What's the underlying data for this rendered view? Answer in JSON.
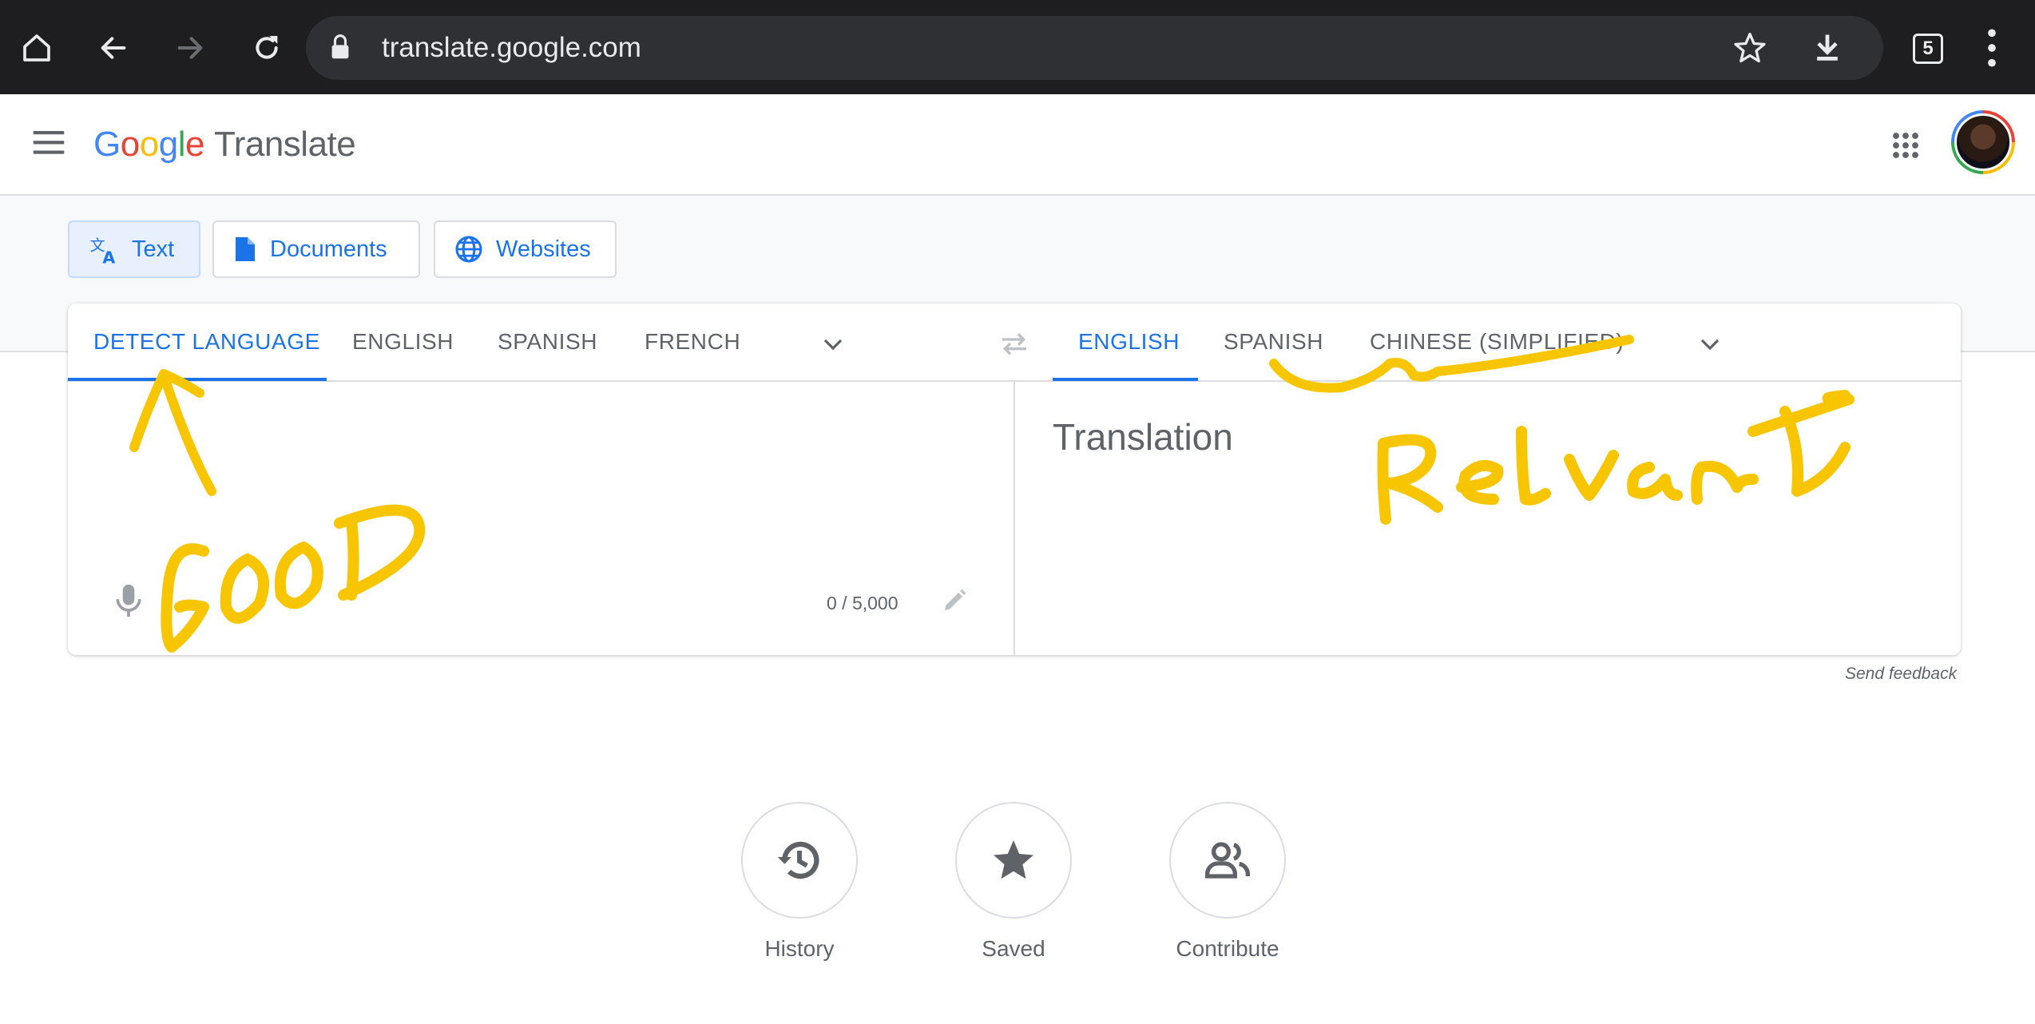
{
  "browser": {
    "url": "translate.google.com",
    "tab_count": "5",
    "icons": [
      "home-icon",
      "back-icon",
      "forward-icon",
      "reload-icon",
      "lock-icon",
      "star-icon",
      "download-icon",
      "tab-switcher-icon",
      "more-vert-icon"
    ]
  },
  "header": {
    "logo_letters": [
      "G",
      "o",
      "o",
      "g",
      "l",
      "e"
    ],
    "product": "Translate",
    "icons": [
      "menu-icon",
      "apps-icon",
      "avatar"
    ]
  },
  "modes": [
    {
      "label": "Text",
      "icon": "translate-icon",
      "active": true
    },
    {
      "label": "Documents",
      "icon": "document-icon",
      "active": false
    },
    {
      "label": "Websites",
      "icon": "globe-icon",
      "active": false
    }
  ],
  "source_languages": [
    "DETECT LANGUAGE",
    "ENGLISH",
    "SPANISH",
    "FRENCH"
  ],
  "target_languages": [
    "ENGLISH",
    "SPANISH",
    "CHINESE (SIMPLIFIED)"
  ],
  "source": {
    "char_count": "0 / 5,000"
  },
  "target": {
    "placeholder": "Translation"
  },
  "feedback_link": "Send feedback",
  "bottom_actions": [
    {
      "label": "History",
      "icon": "history-icon"
    },
    {
      "label": "Saved",
      "icon": "star-icon"
    },
    {
      "label": "Contribute",
      "icon": "people-icon"
    }
  ],
  "annotations": {
    "color": "#f7c600",
    "good_text": "GOOD",
    "relevant_text": "Relevant"
  },
  "colors": {
    "accent": "#1a73e8",
    "chrome_bg": "#1e1e20",
    "text_grey": "#5f6368"
  }
}
